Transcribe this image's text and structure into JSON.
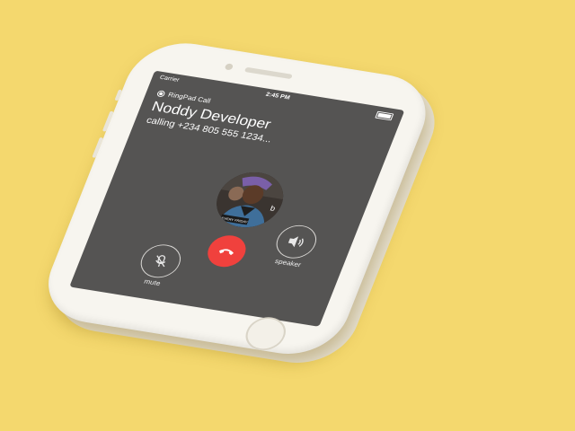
{
  "status_bar": {
    "carrier": "Carrier",
    "time": "2:45 PM"
  },
  "app": {
    "title": "RingPad Call"
  },
  "call": {
    "contact_name": "Noddy Developer",
    "status_text": "calling +234 805 555 1234..."
  },
  "avatar": {
    "shirt_text": "EVERY FRIDAY",
    "side_text": "b"
  },
  "controls": {
    "mute_label": "mute",
    "speaker_label": "speaker"
  },
  "colors": {
    "background": "#F4D86E",
    "screen": "#555453",
    "end_call": "#F0413D",
    "phone_body": "#F7F5EF"
  },
  "icons": {
    "mute": "microphone-slash-icon",
    "end_call": "phone-hangup-icon",
    "speaker": "speaker-volume-icon"
  }
}
